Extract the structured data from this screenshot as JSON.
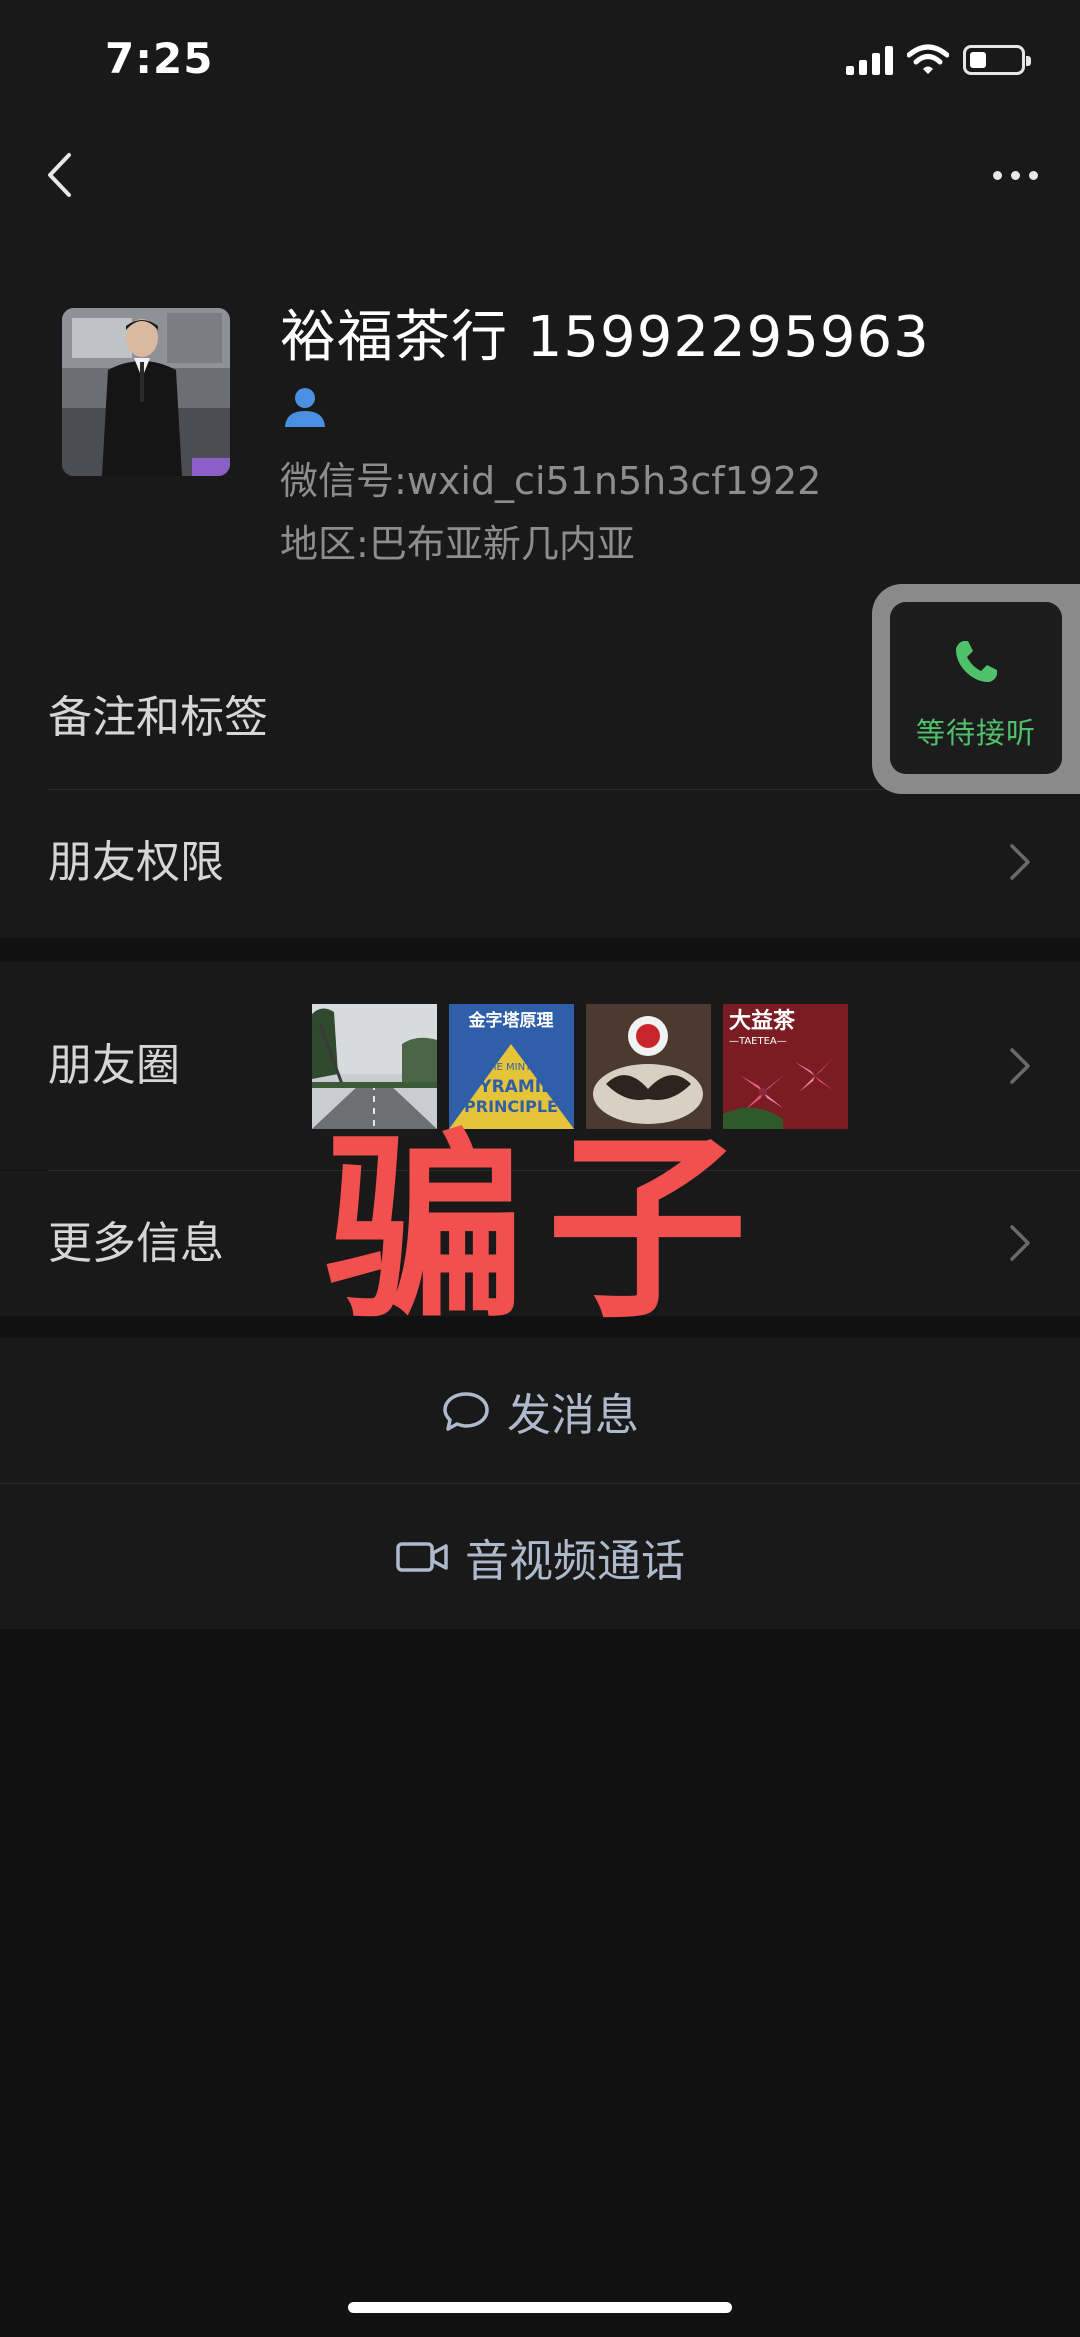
{
  "status_bar": {
    "time": "7:25",
    "icons": [
      "signal-icon",
      "wifi-icon",
      "battery-icon"
    ]
  },
  "nav": {
    "back_icon": "chevron-left-icon",
    "more_icon": "more-dots-icon"
  },
  "profile": {
    "name": "裕福茶行 15992295963",
    "wxid_label": "微信号:",
    "wxid_value": "wxid_ci51n5h3cf1922",
    "region_label": "地区:",
    "region_value": "巴布亚新几内亚",
    "badge_icon": "person-icon"
  },
  "rows": {
    "remark": "备注和标签",
    "permissions": "朋友权限",
    "moments": "朋友圈",
    "more_info": "更多信息"
  },
  "moments_thumbnails": [
    {
      "icon": "road-photo"
    },
    {
      "icon": "book-cover-photo",
      "lines": [
        "金字塔原理",
        "THE MINTO",
        "PYRAMID",
        "PRINCIPLE"
      ]
    },
    {
      "icon": "tea-brand-photo"
    },
    {
      "icon": "lily-tea-photo",
      "lines": [
        "大益茶",
        "—TAETEA—"
      ]
    }
  ],
  "call_widget": {
    "label": "等待接听",
    "icon": "phone-icon",
    "accent": "#4fc16b"
  },
  "overlay_stamp": "骗子",
  "actions": {
    "message": "发消息",
    "message_icon": "chat-bubble-icon",
    "call": "音视频通话",
    "call_icon": "video-camera-icon"
  },
  "colors": {
    "background": "#111111",
    "panel": "#191919",
    "stamp_red": "#f2504e",
    "action_text": "#aeb9cc",
    "badge_blue": "#4a90e2"
  }
}
